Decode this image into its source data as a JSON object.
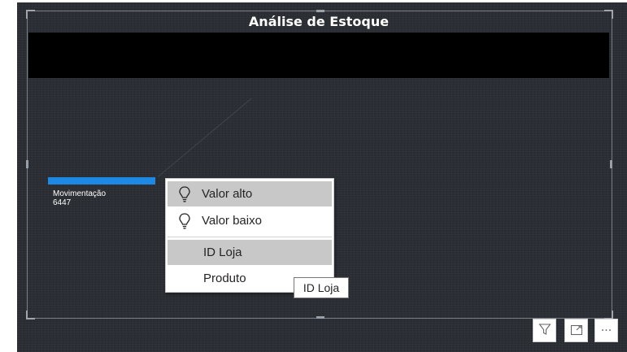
{
  "visual": {
    "title": "Análise de Estoque",
    "bar": {
      "label": "Movimentação",
      "value": "6447",
      "color": "#1e88e5"
    }
  },
  "context_menu": {
    "items": [
      {
        "label": "Valor alto",
        "icon": "lightbulb-icon",
        "highlighted": true
      },
      {
        "label": "Valor baixo",
        "icon": "lightbulb-icon",
        "highlighted": false
      },
      {
        "label": "ID Loja",
        "icon": "",
        "highlighted": true
      },
      {
        "label": "Produto",
        "icon": "",
        "highlighted": false
      }
    ]
  },
  "tooltip": {
    "text": "ID Loja"
  },
  "toolbar": {
    "filter_icon": "filter-icon",
    "focus_icon": "focus-mode-icon",
    "more_label": "···"
  }
}
